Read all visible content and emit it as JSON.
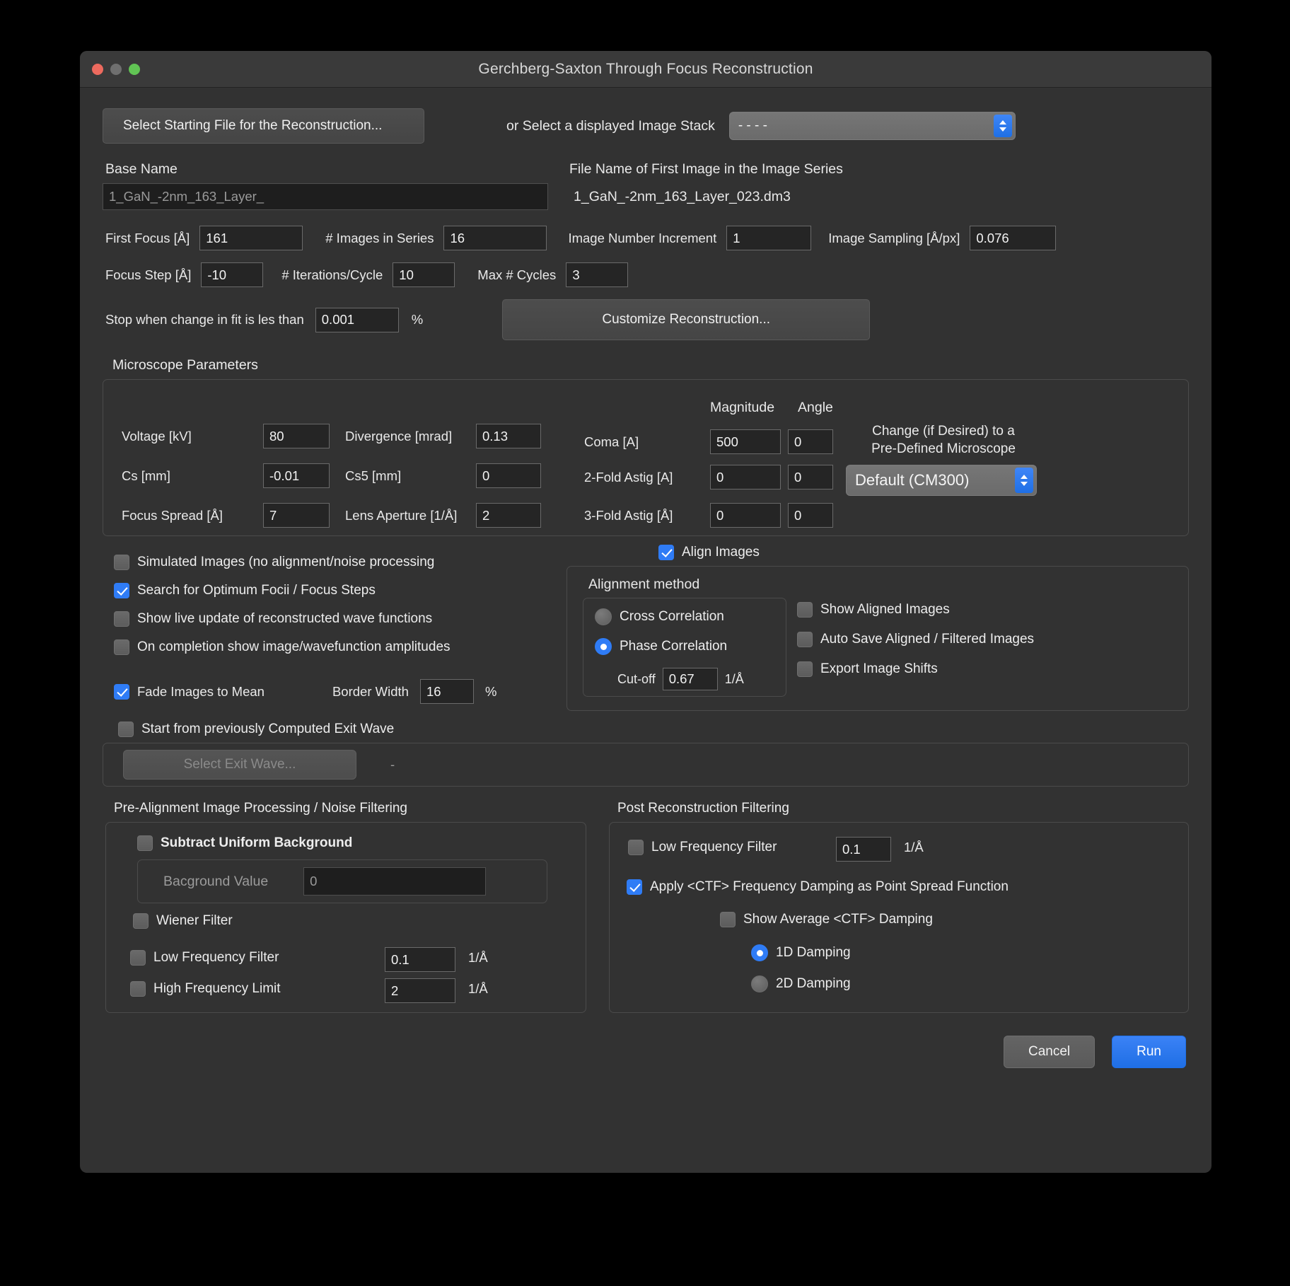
{
  "window": {
    "title": "Gerchberg-Saxton Through Focus Reconstruction",
    "traffic": {
      "close": "close-button",
      "minimize": "minimize-button",
      "zoom": "zoom-button"
    }
  },
  "top": {
    "select_file_button": "Select Starting File for the Reconstruction...",
    "image_stack_label": "or Select a displayed Image Stack",
    "image_stack_value": "- - - -",
    "base_name_label": "Base Name",
    "base_name_value": "1_GaN_-2nm_163_Layer_",
    "first_image_label": "File Name of First Image in the Image Series",
    "first_image_value": "1_GaN_-2nm_163_Layer_023.dm3"
  },
  "params": {
    "first_focus_label": "First Focus [Å]",
    "first_focus_value": "161",
    "num_images_label": "# Images in Series",
    "num_images_value": "16",
    "increment_label": "Image Number Increment",
    "increment_value": "1",
    "sampling_label": "Image Sampling [Å/px]",
    "sampling_value": "0.076",
    "focus_step_label": "Focus Step [Å]",
    "focus_step_value": "-10",
    "iterations_label": "# Iterations/Cycle",
    "iterations_value": "10",
    "max_cycles_label": "Max # Cycles",
    "max_cycles_value": "3",
    "stop_label": "Stop when change in fit is les than",
    "stop_value": "0.001",
    "stop_unit": "%",
    "customize_button": "Customize Reconstruction..."
  },
  "microscope": {
    "group_title": "Microscope Parameters",
    "magnitude_header": "Magnitude",
    "angle_header": "Angle",
    "voltage_label": "Voltage [kV]",
    "voltage_value": "80",
    "divergence_label": "Divergence [mrad]",
    "divergence_value": "0.13",
    "cs_label": "Cs [mm]",
    "cs_value": "-0.01",
    "cs5_label": "Cs5 [mm]",
    "cs5_value": "0",
    "focus_spread_label": "Focus Spread [Å]",
    "focus_spread_value": "7",
    "lens_aperture_label": "Lens Aperture [1/Å]",
    "lens_aperture_value": "2",
    "coma_label": "Coma [A]",
    "coma_mag": "500",
    "coma_angle": "0",
    "astig2_label": "2-Fold Astig [A]",
    "astig2_mag": "0",
    "astig2_angle": "0",
    "astig3_label": "3-Fold Astig [Å]",
    "astig3_mag": "0",
    "astig3_angle": "0",
    "predefined_line1": "Change (if Desired) to a",
    "predefined_line2": "Pre-Defined Microscope",
    "predefined_value": "Default (CM300)"
  },
  "options": {
    "simulated": {
      "label": "Simulated Images (no alignment/noise processing",
      "checked": false
    },
    "search_optimum": {
      "label": "Search for Optimum Focii / Focus Steps",
      "checked": true
    },
    "live_update": {
      "label": "Show live update of reconstructed wave functions",
      "checked": false
    },
    "on_completion": {
      "label": "On completion show image/wavefunction amplitudes",
      "checked": false
    },
    "fade_images": {
      "label": "Fade Images to Mean",
      "checked": true
    },
    "border_width_label": "Border Width",
    "border_width_value": "16",
    "border_width_unit": "%"
  },
  "align": {
    "align_images": {
      "label": "Align Images",
      "checked": true
    },
    "method_title": "Alignment method",
    "cross_correlation": {
      "label": "Cross Correlation",
      "selected": false
    },
    "phase_correlation": {
      "label": "Phase Correlation",
      "selected": true
    },
    "cutoff_label": "Cut-off",
    "cutoff_value": "0.67",
    "cutoff_unit": "1/Å",
    "show_aligned": {
      "label": "Show Aligned Images",
      "checked": false
    },
    "auto_save": {
      "label": "Auto Save Aligned / Filtered Images",
      "checked": false
    },
    "export_shifts": {
      "label": "Export Image Shifts",
      "checked": false
    }
  },
  "exit_wave": {
    "checkbox_label": "Start from previously Computed Exit Wave",
    "checked": false,
    "select_button": "Select Exit Wave...",
    "status": "-"
  },
  "pre_alignment": {
    "title": "Pre-Alignment Image Processing / Noise Filtering",
    "subtract_bg": {
      "label": "Subtract Uniform Background",
      "checked": false
    },
    "bg_value_label": "Bacground Value",
    "bg_value": "0",
    "wiener": {
      "label": "Wiener Filter",
      "checked": false
    },
    "low_freq": {
      "label": "Low Frequency Filter",
      "checked": false
    },
    "low_freq_value": "0.1",
    "low_freq_unit": "1/Å",
    "high_freq": {
      "label": "High Frequency Limit",
      "checked": false
    },
    "high_freq_value": "2",
    "high_freq_unit": "1/Å"
  },
  "post_reconstruction": {
    "title": "Post Reconstruction Filtering",
    "low_freq": {
      "label": "Low Frequency Filter",
      "checked": false
    },
    "low_freq_value": "0.1",
    "low_freq_unit": "1/Å",
    "apply_ctf": {
      "label": "Apply <CTF> Frequency Damping as Point Spread Function",
      "checked": true
    },
    "show_avg_ctf": {
      "label": "Show Average  <CTF>  Damping",
      "checked": false
    },
    "damping_1d": {
      "label": "1D Damping",
      "selected": true
    },
    "damping_2d": {
      "label": "2D Damping",
      "selected": false
    }
  },
  "footer": {
    "cancel": "Cancel",
    "run": "Run"
  },
  "colors": {
    "accent": "#2f7cf6",
    "window_bg": "#323232",
    "titlebar_bg": "#3a3a3a",
    "input_bg": "#252525"
  }
}
